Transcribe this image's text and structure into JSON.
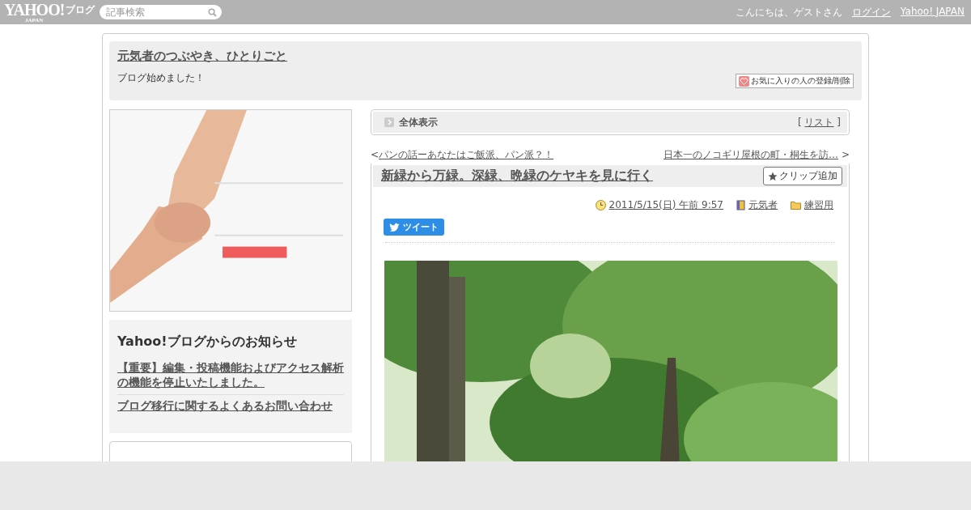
{
  "topbar": {
    "logo": "YAHOO!",
    "logo_sub": "JAPAN",
    "logo_service": "ブログ",
    "search": {
      "placeholder": "記事検索"
    },
    "greeting": "こんにちは、ゲストさん",
    "links": [
      "ログイン",
      "Yahoo! JAPAN"
    ]
  },
  "blog": {
    "title": "元気者のつぶやき、ひとりごと",
    "description": "ブログ始めました！",
    "favorite_button": "お気に入りの人の登録/削除"
  },
  "sidebar": {
    "notice": {
      "title": "Yahoo!ブログからのお知らせ",
      "links": [
        "【重要】編集・投稿機能およびアクセス解析の機能を停止いたしました。",
        "ブログ移行に関するよくあるお問い合わせ"
      ]
    }
  },
  "view_bar": {
    "label": "全体表示",
    "open_bracket": "[",
    "list_link": "リスト",
    "close_bracket": "]"
  },
  "nav": {
    "prev_marker": "<",
    "prev": "パンの話ーあなたはご飯派、パン派？！",
    "next": "日本一のノコギリ屋根の町・桐生を訪…",
    "next_marker": ">"
  },
  "article": {
    "title": "新緑から万緑。深緑、晩緑のケヤキを見に行く",
    "clip_button": "クリップ追加",
    "date": "2011/5/15(日) 午前 9:57",
    "author": "元気者",
    "category": "練習用",
    "tweet_button": "ツイート"
  }
}
